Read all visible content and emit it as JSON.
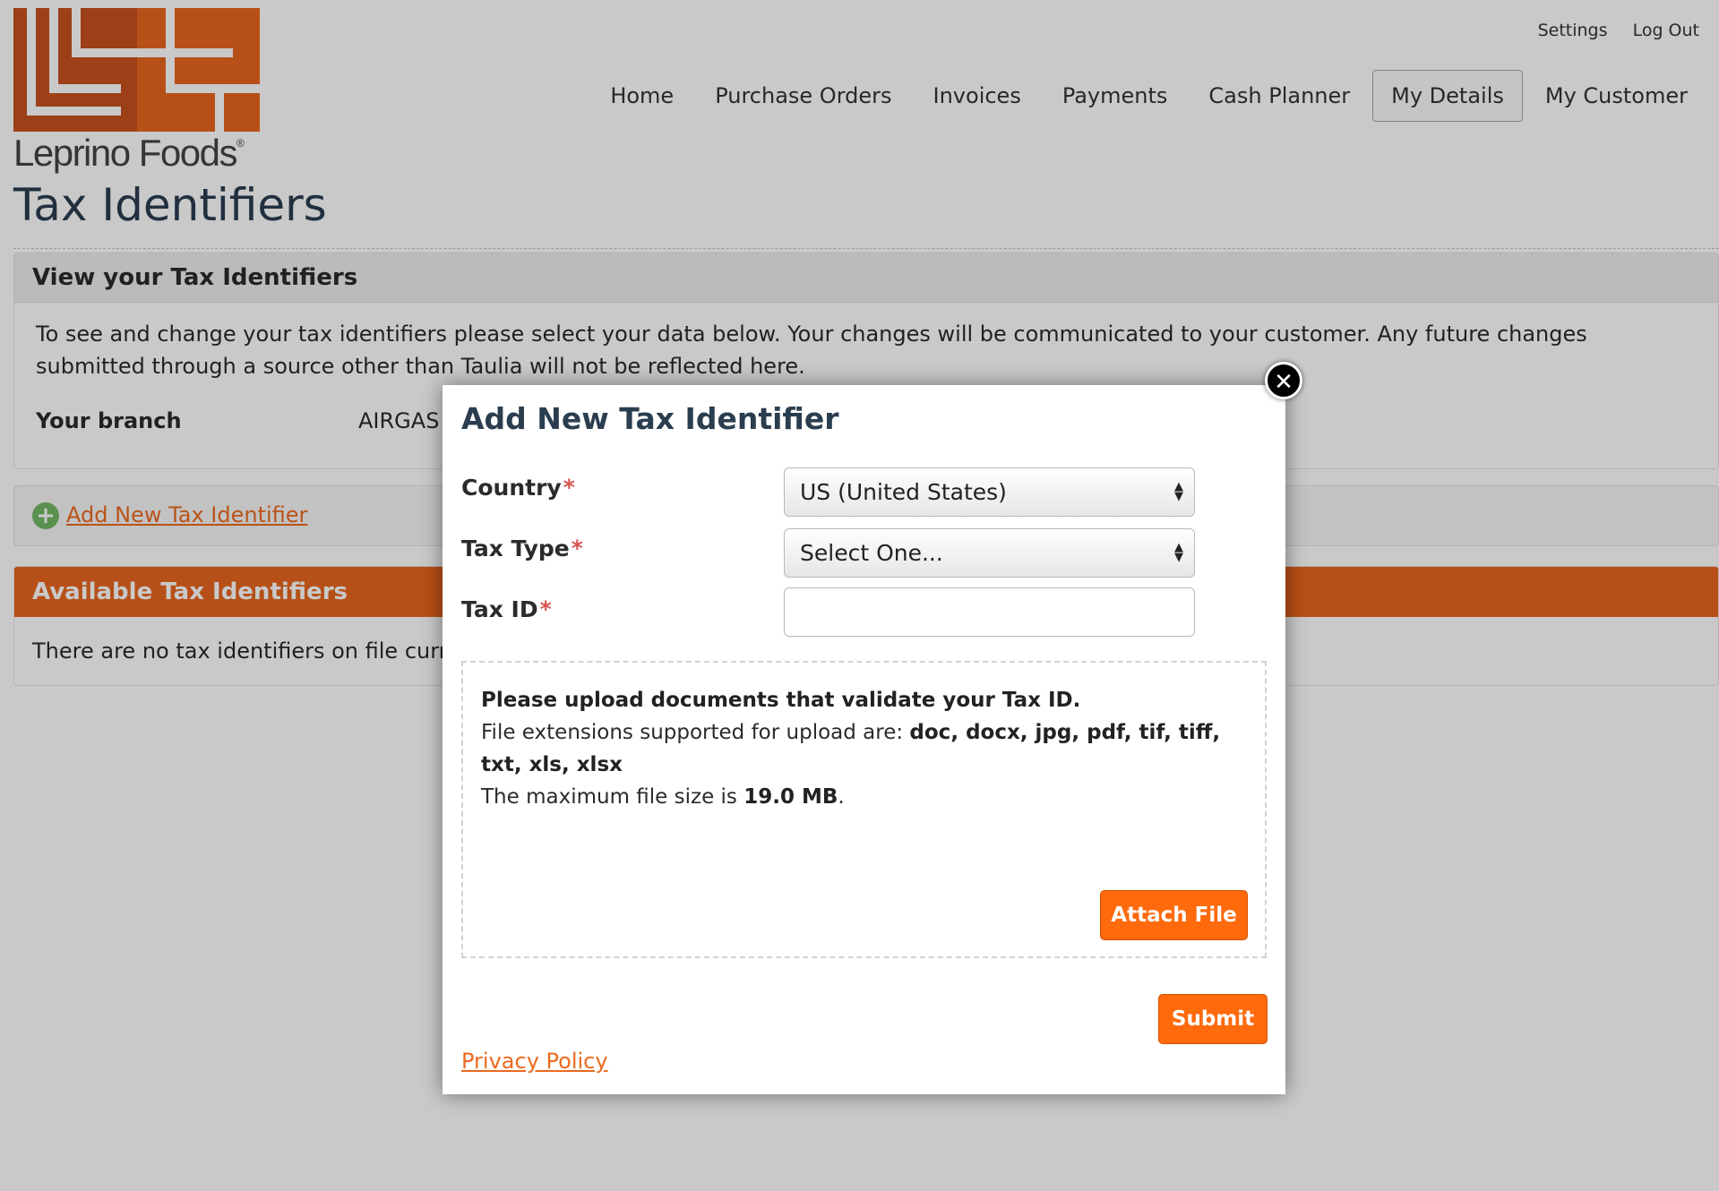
{
  "brand": {
    "name": "Leprino Foods",
    "registered_mark": "®",
    "color": "#e8661f"
  },
  "top_links": {
    "settings": "Settings",
    "logout": "Log Out"
  },
  "nav": [
    {
      "label": "Home",
      "active": false
    },
    {
      "label": "Purchase Orders",
      "active": false
    },
    {
      "label": "Invoices",
      "active": false
    },
    {
      "label": "Payments",
      "active": false
    },
    {
      "label": "Cash Planner",
      "active": false
    },
    {
      "label": "My Details",
      "active": true
    },
    {
      "label": "My Customer",
      "active": false
    }
  ],
  "page": {
    "title": "Tax Identifiers",
    "view_panel": {
      "heading": "View your Tax Identifiers",
      "description": "To see and change your tax identifiers please select your data below. Your changes will be communicated to your customer. Any future changes submitted through a source other than Taulia will not be reflected here.",
      "branch_label": "Your branch",
      "branch_value": "AIRGAS U"
    },
    "add_link": {
      "label": "Add New Tax Identifier",
      "icon": "plus-circle-icon"
    },
    "available_panel": {
      "heading": "Available Tax Identifiers",
      "empty_text": "There are no tax identifiers on file currently."
    }
  },
  "modal": {
    "title": "Add New Tax Identifier",
    "close_icon": "close-icon",
    "required_marker": "*",
    "fields": {
      "country": {
        "label": "Country",
        "value": "US (United States)"
      },
      "tax_type": {
        "label": "Tax Type",
        "value": "Select One..."
      },
      "tax_id": {
        "label": "Tax ID",
        "value": ""
      }
    },
    "upload": {
      "heading": "Please upload documents that validate your Tax ID.",
      "extensions_prefix": "File extensions supported for upload are: ",
      "extensions": "doc, docx, jpg, pdf, tif, tiff, txt, xls, xlsx",
      "max_prefix": "The maximum file size is ",
      "max_size": "19.0 MB",
      "max_suffix": ".",
      "attach_label": "Attach File"
    },
    "submit_label": "Submit",
    "privacy_label": "Privacy Policy"
  }
}
